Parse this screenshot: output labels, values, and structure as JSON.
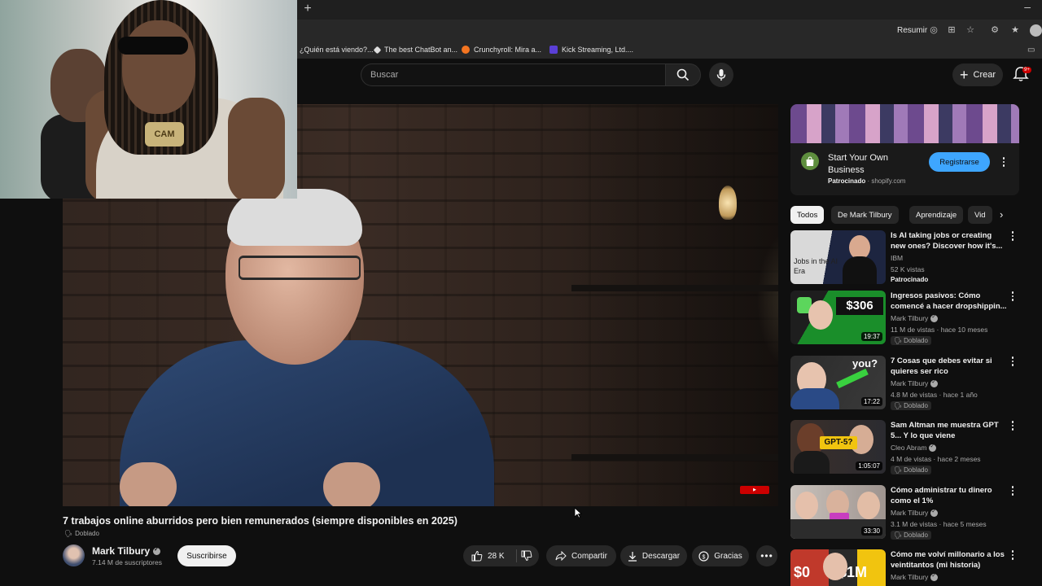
{
  "browser": {
    "new_tab_icon": "plus-icon",
    "summary_label": "Resumir",
    "bookmarks": [
      {
        "label": "¿Quién está viendo?...",
        "color": "#e50914"
      },
      {
        "label": "The best ChatBot an...",
        "color": "#dddddd"
      },
      {
        "label": "Crunchyroll: Mira a...",
        "color": "#f47521"
      },
      {
        "label": "Kick Streaming, Ltd....",
        "color": "#5a3fd6"
      }
    ]
  },
  "masthead": {
    "search_placeholder": "Buscar",
    "create_label": "Crear",
    "notifications_badge": "9+"
  },
  "video": {
    "title": "7 trabajos online aburridos pero bien remunerados (siempre disponibles en 2025)",
    "dub_label": "Doblado",
    "channel_name": "Mark Tilbury",
    "subscribers": "7.14 M de suscriptores",
    "subscribe_label": "Suscribirse",
    "likes": "28 K",
    "share_label": "Compartir",
    "download_label": "Descargar",
    "thanks_label": "Gracias",
    "pip_chain_text": "CAM"
  },
  "ad": {
    "title": "Start Your Own Business",
    "sponsored": "Patrocinado",
    "domain": "shopify.com",
    "button_label": "Registrarse"
  },
  "chips": [
    "Todos",
    "De Mark Tilbury",
    "Aprendizaje",
    "Vid"
  ],
  "recommendations": [
    {
      "title": "Is AI taking jobs or creating new ones? Discover how it's...",
      "channel": "IBM",
      "stats": "52 K vistas",
      "tag": "Patrocinado",
      "duration": "",
      "thumb_text": "Jobs in the AI Era",
      "verified": false
    },
    {
      "title": "Ingresos pasivos: Cómo comencé a hacer dropshippin...",
      "channel": "Mark Tilbury",
      "stats": "11 M de vistas · hace 10 meses",
      "tag": "Doblado",
      "duration": "19:37",
      "thumb_text": "$306 PER DAY",
      "verified": true
    },
    {
      "title": "7 Cosas que debes evitar si quieres ser rico",
      "channel": "Mark Tilbury",
      "stats": "4.8 M de vistas · hace 1 año",
      "tag": "Doblado",
      "duration": "17:22",
      "thumb_text": "you?",
      "verified": true
    },
    {
      "title": "Sam Altman me muestra GPT 5... Y lo que viene",
      "channel": "Cleo Abram",
      "stats": "4 M de vistas · hace 2 meses",
      "tag": "Doblado",
      "duration": "1:05:07",
      "thumb_text": "GPT-5?",
      "verified": true
    },
    {
      "title": "Cómo administrar tu dinero como el 1%",
      "channel": "Mark Tilbury",
      "stats": "3.1 M de vistas · hace 5 meses",
      "tag": "Doblado",
      "duration": "33:30",
      "thumb_text": "",
      "verified": true
    },
    {
      "title": "Cómo me volví millonario a los veintitantos (mi historia)",
      "channel": "Mark Tilbury",
      "stats": "",
      "tag": "",
      "duration": "",
      "thumb_text": "$0 $1M",
      "verified": true
    }
  ]
}
